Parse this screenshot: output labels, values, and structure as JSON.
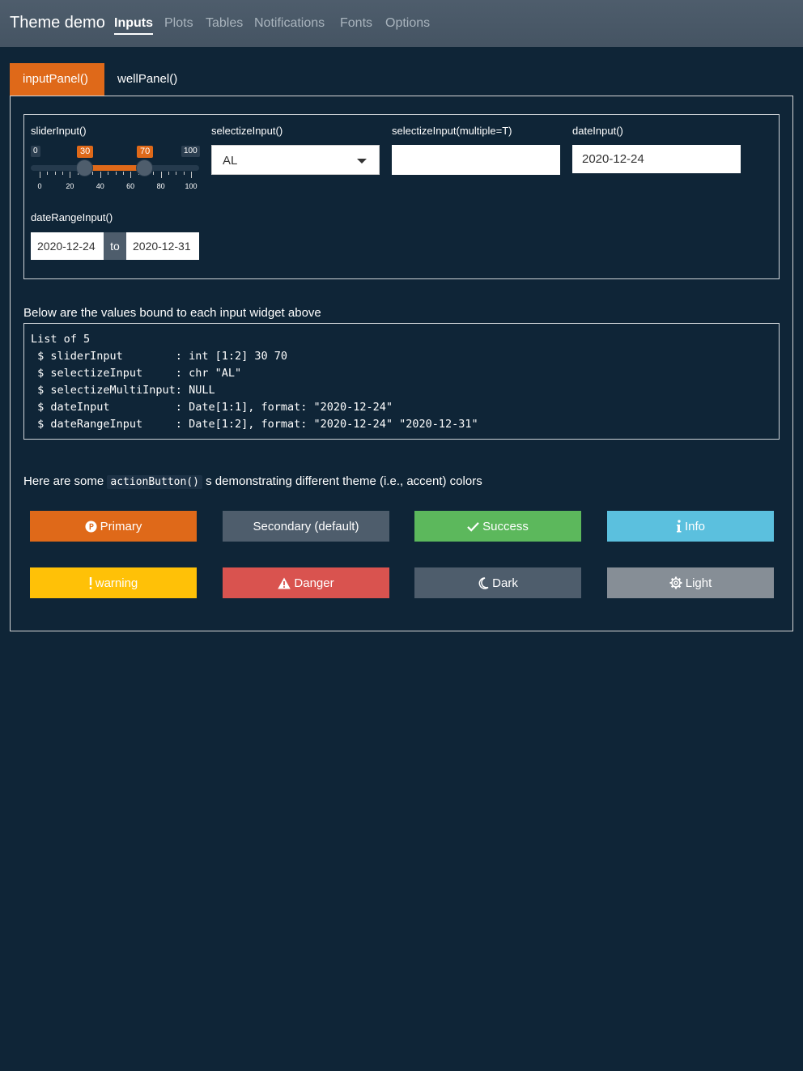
{
  "navbar": {
    "brand": "Theme demo",
    "links": [
      "Inputs",
      "Plots",
      "Tables",
      "Notifications",
      "Fonts",
      "Options"
    ],
    "active": "Inputs"
  },
  "tabs": [
    "inputPanel()",
    "wellPanel()"
  ],
  "inputs": {
    "slider": {
      "label": "sliderInput()",
      "min": "0",
      "max": "100",
      "from": "30",
      "to": "70",
      "ticks": [
        "0",
        "20",
        "40",
        "60",
        "80",
        "100"
      ]
    },
    "selectize": {
      "label": "selectizeInput()",
      "value": "AL"
    },
    "selectize_multi": {
      "label": "selectizeInput(multiple=T)",
      "value": ""
    },
    "date": {
      "label": "dateInput()",
      "value": "2020-12-24"
    },
    "date_range": {
      "label": "dateRangeInput()",
      "start": "2020-12-24",
      "separator": "to",
      "end": "2020-12-31"
    }
  },
  "values_caption": "Below are the values bound to each input widget above",
  "output_lines": [
    "List of 5",
    " $ sliderInput        : int [1:2] 30 70",
    " $ selectizeInput     : chr \"AL\"",
    " $ selectizeMultiInput: NULL",
    " $ dateInput          : Date[1:1], format: \"2020-12-24\"",
    " $ dateRangeInput     : Date[1:2], format: \"2020-12-24\" \"2020-12-31\""
  ],
  "buttons_caption": {
    "before": "Here are some",
    "code": "actionButton()",
    "after": "s demonstrating different theme (i.e., accent) colors"
  },
  "buttons": [
    {
      "label": "Primary",
      "icon": "p-circle-icon",
      "color": "#df6919"
    },
    {
      "label": "Secondary (default)",
      "icon": "",
      "color": "#4e5d6c"
    },
    {
      "label": "Success",
      "icon": "check-icon",
      "color": "#5cb85c"
    },
    {
      "label": "Info",
      "icon": "info-icon",
      "color": "#5bc0de"
    },
    {
      "label": "warning",
      "icon": "exclamation-icon",
      "color": "#ffc107"
    },
    {
      "label": "Danger",
      "icon": "warning-triangle-icon",
      "color": "#d9534f"
    },
    {
      "label": "Dark",
      "icon": "moon-icon",
      "color": "#4e5d6c"
    },
    {
      "label": "Light",
      "icon": "gear-icon",
      "color": "#868e96"
    }
  ]
}
